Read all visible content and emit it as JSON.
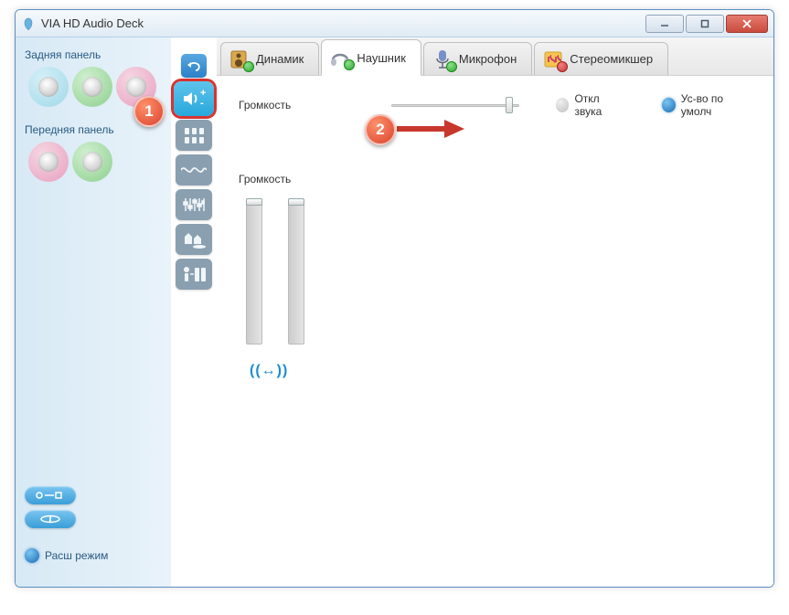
{
  "window": {
    "title": "VIA HD Audio Deck"
  },
  "left": {
    "rear_label": "Задняя панель",
    "front_label": "Передняя панель",
    "ext_mode_label": "Расш режим"
  },
  "tabs": {
    "speaker": "Динамик",
    "headphone": "Наушник",
    "mic": "Микрофон",
    "stereomix": "Стереомикшер"
  },
  "main": {
    "volume_label": "Громкость",
    "mute_label": "Откл звука",
    "default_label": "Ус-во по умолч",
    "channel_volume_label": "Громкость",
    "master_volume_pct": 92,
    "channel_left_pct": 100,
    "channel_right_pct": 100
  },
  "callouts": {
    "c1": "1",
    "c2": "2"
  },
  "chart_data": null
}
